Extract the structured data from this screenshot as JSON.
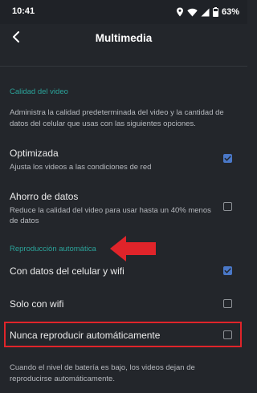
{
  "status_bar": {
    "time": "10:41",
    "battery": "63%",
    "icons": [
      "location-icon",
      "wifi-icon",
      "signal-icon",
      "battery-icon"
    ]
  },
  "app_bar": {
    "title": "Multimedia",
    "back_icon": "back-arrow-icon"
  },
  "sections": {
    "video_quality": {
      "header": "Calidad del video",
      "description": "Administra la calidad predeterminada del video y la cantidad de datos del celular que usas con las siguientes opciones."
    },
    "autoplay": {
      "header": "Reproducción automática",
      "footer": "Cuando el nivel de batería es bajo, los videos dejan de reproducirse automáticamente."
    }
  },
  "options": {
    "optimized": {
      "title": "Optimizada",
      "subtitle": "Ajusta los videos a las condiciones de red",
      "checked": true
    },
    "data_saver": {
      "title": "Ahorro de datos",
      "subtitle": "Reduce la calidad del video para usar hasta un 40% menos de datos",
      "checked": false
    },
    "mobile_and_wifi": {
      "title": "Con datos del celular y wifi",
      "checked": true
    },
    "wifi_only": {
      "title": "Solo con wifi",
      "checked": false
    },
    "never": {
      "title": "Nunca reproducir automáticamente",
      "checked": false
    }
  },
  "colors": {
    "background": "#23262b",
    "accent_teal": "#2ba39a",
    "checkbox_checked": "#4a78c8",
    "annotation_red": "#e0242a"
  }
}
